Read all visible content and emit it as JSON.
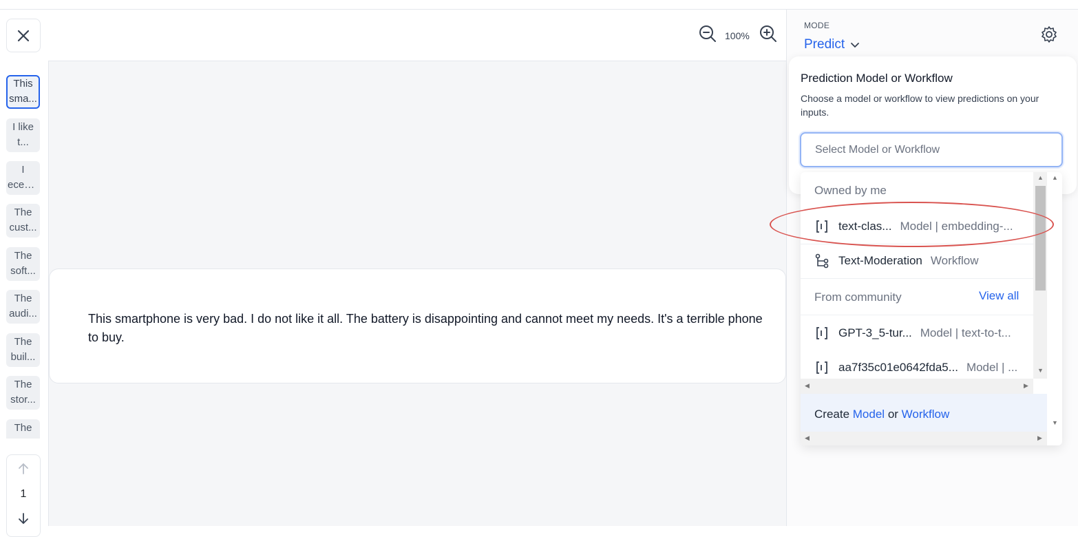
{
  "sidebar": {
    "close_icon": "close-icon",
    "items": [
      {
        "l1": "This",
        "l2": "sma..."
      },
      {
        "l1": "I like",
        "l2": "t..."
      },
      {
        "l1": "I",
        "l2": "ecent..."
      },
      {
        "l1": "The",
        "l2": "cust..."
      },
      {
        "l1": "The",
        "l2": "soft..."
      },
      {
        "l1": "The",
        "l2": "audi..."
      },
      {
        "l1": "The",
        "l2": "buil..."
      },
      {
        "l1": "The",
        "l2": "stor..."
      },
      {
        "l1": "The",
        "l2": ""
      }
    ],
    "page_number": "1"
  },
  "toolbar": {
    "zoom_level": "100%"
  },
  "canvas": {
    "input_text": "This smartphone is very bad. I do not like it all. The battery is disappointing and cannot meet my needs. It's a terrible phone to buy."
  },
  "panel": {
    "mode_label": "MODE",
    "mode_value": "Predict",
    "card_title": "Prediction Model or Workflow",
    "card_desc": "Choose a model or workflow to view predictions on your inputs.",
    "select_placeholder": "Select Model or Workflow"
  },
  "dropdown": {
    "group_owned": "Owned by me",
    "owned": [
      {
        "name": "text-clas...",
        "meta": "Model | embedding-...",
        "icon": "model-icon"
      },
      {
        "name": "Text-Moderation",
        "meta": "Workflow",
        "icon": "workflow-icon"
      }
    ],
    "group_community": "From community",
    "view_all": "View all",
    "community": [
      {
        "name": "GPT-3_5-tur...",
        "meta": "Model | text-to-t...",
        "icon": "model-icon"
      },
      {
        "name": "aa7f35c01e0642fda5...",
        "meta": "Model | ...",
        "icon": "model-icon"
      }
    ],
    "create_prefix": "Create",
    "create_model": "Model",
    "create_or": "or",
    "create_workflow": "Workflow"
  },
  "colors": {
    "accent": "#2563eb",
    "annotation": "#d9534f"
  }
}
